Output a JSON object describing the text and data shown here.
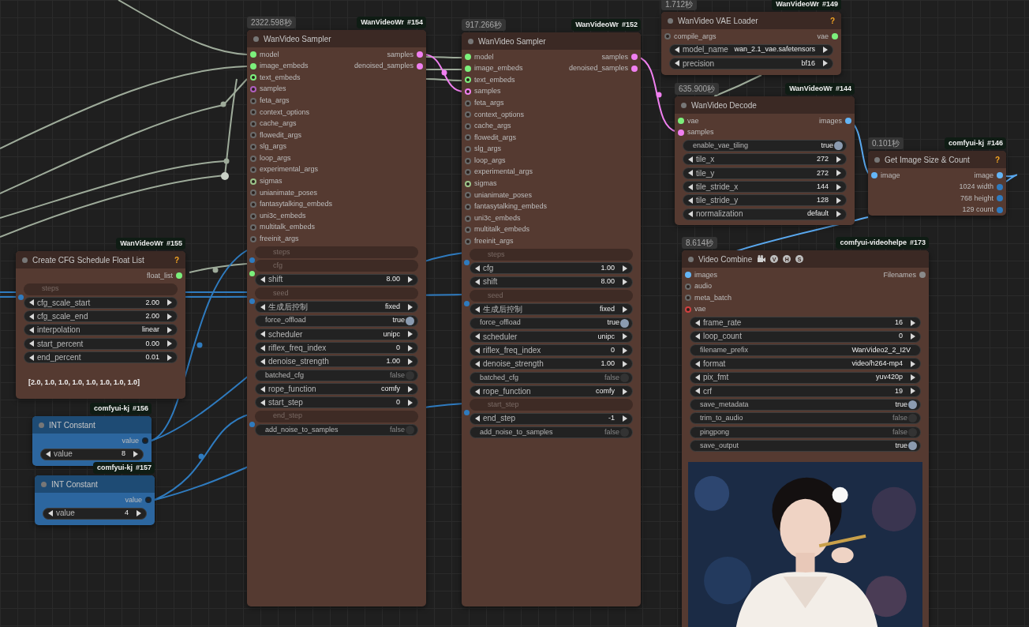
{
  "nodes": [
    {
      "source": "WanVideoWr",
      "id": "#155",
      "title": "Create CFG Schedule Float List",
      "help": "?",
      "color": "#553a31",
      "outputs": [
        {
          "label": "float_list",
          "color": "#7cf07c",
          "connected": true
        }
      ],
      "widgets": [
        {
          "kind": "input",
          "label": "steps",
          "color": "#2f7bbf"
        },
        {
          "kind": "stepper",
          "label": "cfg_scale_start",
          "value": "2.00"
        },
        {
          "kind": "stepper",
          "label": "cfg_scale_end",
          "value": "2.00"
        },
        {
          "kind": "stepper",
          "label": "interpolation",
          "value": "linear"
        },
        {
          "kind": "stepper",
          "label": "start_percent",
          "value": "0.00"
        },
        {
          "kind": "stepper",
          "label": "end_percent",
          "value": "0.01"
        }
      ],
      "preview": {
        "kind": "text",
        "text": "[2.0, 1.0, 1.0, 1.0, 1.0, 1.0, 1.0, 1.0]"
      }
    },
    {
      "source": "comfyui-kj",
      "id": "#156",
      "title": "INT Constant",
      "color": "#2c669f",
      "outputs": [
        {
          "label": "value",
          "color": "#10263a",
          "connected": false
        }
      ],
      "widgets": [
        {
          "kind": "stepper",
          "label": "value",
          "value": "8"
        }
      ]
    },
    {
      "source": "comfyui-kj",
      "id": "#157",
      "title": "INT Constant",
      "color": "#2c669f",
      "outputs": [
        {
          "label": "value",
          "color": "#10263a",
          "connected": false
        }
      ],
      "widgets": [
        {
          "kind": "stepper",
          "label": "value",
          "value": "4"
        }
      ]
    },
    {
      "time": "2322.598秒",
      "source": "WanVideoWr",
      "id": "#154",
      "title": "WanVideo Sampler",
      "color": "#553a31",
      "inputs": [
        {
          "label": "model",
          "color": "#7cf07c",
          "connected": true
        },
        {
          "label": "image_embeds",
          "color": "#7cf07c",
          "connected": true
        },
        {
          "label": "text_embeds",
          "color": "#7cf07c",
          "connected": false
        },
        {
          "label": "samples",
          "color": "#b060c0",
          "connected": false
        },
        {
          "label": "feta_args",
          "color": "#6a6a6a",
          "connected": false
        },
        {
          "label": "context_options",
          "color": "#6a6a6a",
          "connected": false
        },
        {
          "label": "cache_args",
          "color": "#6a6a6a",
          "connected": false
        },
        {
          "label": "flowedit_args",
          "color": "#6a6a6a",
          "connected": false
        },
        {
          "label": "slg_args",
          "color": "#6a6a6a",
          "connected": false
        },
        {
          "label": "loop_args",
          "color": "#6a6a6a",
          "connected": false
        },
        {
          "label": "experimental_args",
          "color": "#6a6a6a",
          "connected": false
        },
        {
          "label": "sigmas",
          "color": "#9cc48a",
          "connected": false
        },
        {
          "label": "unianimate_poses",
          "color": "#6a6a6a",
          "connected": false
        },
        {
          "label": "fantasytalking_embeds",
          "color": "#6a6a6a",
          "connected": false
        },
        {
          "label": "uni3c_embeds",
          "color": "#6a6a6a",
          "connected": false
        },
        {
          "label": "multitalk_embeds",
          "color": "#6a6a6a",
          "connected": false
        },
        {
          "label": "freeinit_args",
          "color": "#6a6a6a",
          "connected": false
        }
      ],
      "outputs": [
        {
          "label": "samples",
          "color": "#f080f0",
          "connected": true
        },
        {
          "label": "denoised_samples",
          "color": "#f080f0",
          "connected": true
        }
      ],
      "widgets": [
        {
          "kind": "input",
          "label": "steps",
          "color": "#2f7bbf"
        },
        {
          "kind": "input",
          "label": "cfg",
          "color": "#7cf07c"
        },
        {
          "kind": "stepper",
          "label": "shift",
          "value": "8.00"
        },
        {
          "kind": "input",
          "label": "seed",
          "color": "#2f7bbf"
        },
        {
          "kind": "stepper",
          "label": "生成后控制",
          "value": "fixed"
        },
        {
          "kind": "toggle",
          "label": "force_offload",
          "value": "true",
          "on": true
        },
        {
          "kind": "stepper",
          "label": "scheduler",
          "value": "unipc"
        },
        {
          "kind": "stepper",
          "label": "riflex_freq_index",
          "value": "0"
        },
        {
          "kind": "stepper",
          "label": "denoise_strength",
          "value": "1.00"
        },
        {
          "kind": "toggle",
          "label": "batched_cfg",
          "value": "false",
          "on": false
        },
        {
          "kind": "stepper",
          "label": "rope_function",
          "value": "comfy"
        },
        {
          "kind": "stepper",
          "label": "start_step",
          "value": "0"
        },
        {
          "kind": "input",
          "label": "end_step",
          "color": "#2f7bbf"
        },
        {
          "kind": "toggle",
          "label": "add_noise_to_samples",
          "value": "false",
          "on": false
        }
      ]
    },
    {
      "time": "917.266秒",
      "source": "WanVideoWr",
      "id": "#152",
      "title": "WanVideo Sampler",
      "color": "#553a31",
      "inputs": [
        {
          "label": "model",
          "color": "#7cf07c",
          "connected": true
        },
        {
          "label": "image_embeds",
          "color": "#7cf07c",
          "connected": true
        },
        {
          "label": "text_embeds",
          "color": "#7cf07c",
          "connected": false
        },
        {
          "label": "samples",
          "color": "#f080f0",
          "connected": false
        },
        {
          "label": "feta_args",
          "color": "#6a6a6a",
          "connected": false
        },
        {
          "label": "context_options",
          "color": "#6a6a6a",
          "connected": false
        },
        {
          "label": "cache_args",
          "color": "#6a6a6a",
          "connected": false
        },
        {
          "label": "flowedit_args",
          "color": "#6a6a6a",
          "connected": false
        },
        {
          "label": "slg_args",
          "color": "#6a6a6a",
          "connected": false
        },
        {
          "label": "loop_args",
          "color": "#6a6a6a",
          "connected": false
        },
        {
          "label": "experimental_args",
          "color": "#6a6a6a",
          "connected": false
        },
        {
          "label": "sigmas",
          "color": "#9cc48a",
          "connected": false
        },
        {
          "label": "unianimate_poses",
          "color": "#6a6a6a",
          "connected": false
        },
        {
          "label": "fantasytalking_embeds",
          "color": "#6a6a6a",
          "connected": false
        },
        {
          "label": "uni3c_embeds",
          "color": "#6a6a6a",
          "connected": false
        },
        {
          "label": "multitalk_embeds",
          "color": "#6a6a6a",
          "connected": false
        },
        {
          "label": "freeinit_args",
          "color": "#6a6a6a",
          "connected": false
        }
      ],
      "outputs": [
        {
          "label": "samples",
          "color": "#f080f0",
          "connected": true
        },
        {
          "label": "denoised_samples",
          "color": "#f080f0",
          "connected": true
        }
      ],
      "widgets": [
        {
          "kind": "input",
          "label": "steps",
          "color": "#2f7bbf"
        },
        {
          "kind": "stepper",
          "label": "cfg",
          "value": "1.00"
        },
        {
          "kind": "stepper",
          "label": "shift",
          "value": "8.00"
        },
        {
          "kind": "input",
          "label": "seed",
          "color": "#2f7bbf"
        },
        {
          "kind": "stepper",
          "label": "生成后控制",
          "value": "fixed"
        },
        {
          "kind": "toggle",
          "label": "force_offload",
          "value": "true",
          "on": true
        },
        {
          "kind": "stepper",
          "label": "scheduler",
          "value": "unipc"
        },
        {
          "kind": "stepper",
          "label": "riflex_freq_index",
          "value": "0"
        },
        {
          "kind": "stepper",
          "label": "denoise_strength",
          "value": "1.00"
        },
        {
          "kind": "toggle",
          "label": "batched_cfg",
          "value": "false",
          "on": false
        },
        {
          "kind": "stepper",
          "label": "rope_function",
          "value": "comfy"
        },
        {
          "kind": "input",
          "label": "start_step",
          "color": "#2f7bbf"
        },
        {
          "kind": "stepper",
          "label": "end_step",
          "value": "-1"
        },
        {
          "kind": "toggle",
          "label": "add_noise_to_samples",
          "value": "false",
          "on": false
        }
      ]
    },
    {
      "time": "1.712秒",
      "source": "WanVideoWr",
      "id": "#149",
      "title": "WanVideo VAE Loader",
      "help": "?",
      "color": "#553a31",
      "inputs": [
        {
          "label": "compile_args",
          "color": "#6a6a6a",
          "connected": false
        }
      ],
      "outputs": [
        {
          "label": "vae",
          "color": "#7cf07c",
          "connected": true
        }
      ],
      "widgets": [
        {
          "kind": "stepper",
          "label": "model_name",
          "value": "wan_2.1_vae.safetensors"
        },
        {
          "kind": "stepper",
          "label": "precision",
          "value": "bf16"
        }
      ]
    },
    {
      "time": "635.900秒",
      "source": "WanVideoWr",
      "id": "#144",
      "title": "WanVideo Decode",
      "color": "#553a31",
      "inputs": [
        {
          "label": "vae",
          "color": "#7cf07c",
          "connected": true
        },
        {
          "label": "samples",
          "color": "#f080f0",
          "connected": true
        }
      ],
      "outputs": [
        {
          "label": "images",
          "color": "#64b5f6",
          "connected": true
        }
      ],
      "widgets": [
        {
          "kind": "toggle",
          "label": "enable_vae_tiling",
          "value": "true",
          "on": true
        },
        {
          "kind": "stepper",
          "label": "tile_x",
          "value": "272"
        },
        {
          "kind": "stepper",
          "label": "tile_y",
          "value": "272"
        },
        {
          "kind": "stepper",
          "label": "tile_stride_x",
          "value": "144"
        },
        {
          "kind": "stepper",
          "label": "tile_stride_y",
          "value": "128"
        },
        {
          "kind": "stepper",
          "label": "normalization",
          "value": "default"
        }
      ]
    },
    {
      "time": "0.101秒",
      "source": "comfyui-kj",
      "id": "#146",
      "title": "Get Image Size & Count",
      "help": "?",
      "color": "#553a31",
      "inputs": [
        {
          "label": "image",
          "color": "#64b5f6",
          "connected": true
        }
      ],
      "outputs": [
        {
          "label": "image",
          "color": "#64b5f6",
          "connected": true
        },
        {
          "label": "1024 width",
          "color": "#2f7bbf",
          "connected": true
        },
        {
          "label": "768 height",
          "color": "#2f7bbf",
          "connected": true
        },
        {
          "label": "129 count",
          "color": "#2f7bbf",
          "connected": true
        }
      ]
    },
    {
      "time": "8.614秒",
      "source": "comfyui-videohelpe",
      "id": "#173",
      "title": "Video Combine",
      "tags": [
        "V",
        "H",
        "S"
      ],
      "color": "#553a31",
      "inputs": [
        {
          "label": "images",
          "color": "#64b5f6",
          "connected": true
        },
        {
          "label": "audio",
          "color": "#6a6a6a",
          "connected": false
        },
        {
          "label": "meta_batch",
          "color": "#6a6a6a",
          "connected": false
        },
        {
          "label": "vae",
          "color": "#d04040",
          "connected": false
        }
      ],
      "outputs": [
        {
          "label": "Filenames",
          "color": "#8a8a8a",
          "connected": true
        }
      ],
      "widgets": [
        {
          "kind": "stepper",
          "label": "frame_rate",
          "value": "16"
        },
        {
          "kind": "stepper",
          "label": "loop_count",
          "value": "0"
        },
        {
          "kind": "text",
          "label": "filename_prefix",
          "value": "WanVideo2_2_I2V"
        },
        {
          "kind": "stepper",
          "label": "format",
          "value": "video/h264-mp4"
        },
        {
          "kind": "stepper",
          "label": "pix_fmt",
          "value": "yuv420p"
        },
        {
          "kind": "stepper",
          "label": "crf",
          "value": "19"
        },
        {
          "kind": "toggle",
          "label": "save_metadata",
          "value": "true",
          "on": true
        },
        {
          "kind": "toggle",
          "label": "trim_to_audio",
          "value": "false",
          "on": false
        },
        {
          "kind": "toggle",
          "label": "pingpong",
          "value": "false",
          "on": false
        },
        {
          "kind": "toggle",
          "label": "save_output",
          "value": "true",
          "on": true
        }
      ],
      "preview": {
        "kind": "picture"
      }
    }
  ]
}
